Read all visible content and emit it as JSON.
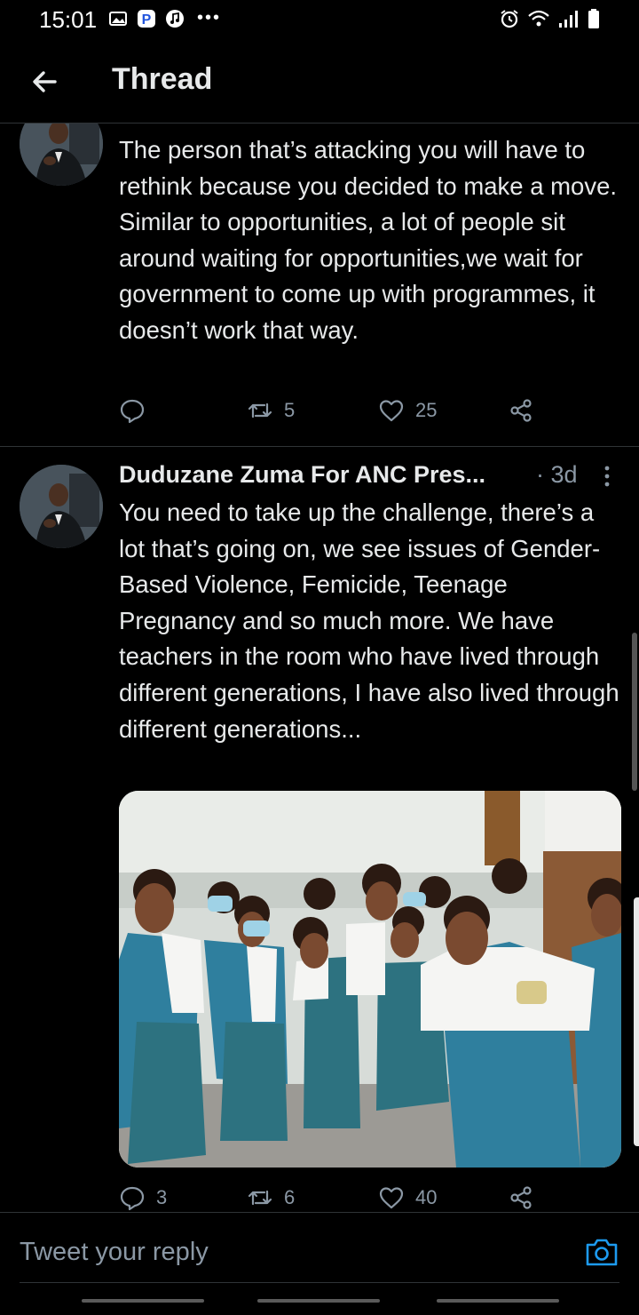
{
  "status_bar": {
    "time": "15:01",
    "dots": "•••"
  },
  "header": {
    "title": "Thread"
  },
  "tweets": [
    {
      "text": "The person that’s attacking you will have to rethink because you decided to  make a move. Similar to opportunities, a lot of people sit around waiting for opportunities,we wait for government to come up with programmes,  it doesn’t work that way.",
      "replies": "",
      "retweets": "5",
      "likes": "25"
    },
    {
      "author": "Duduzane Zuma For ANC Pres...",
      "meta": "· 3d",
      "text": "You need to take up the challenge, there’s a lot that’s going on, we see issues of Gender-Based Violence, Femicide, Teenage Pregnancy and so much more. We have teachers in the room who have lived through different generations, I have also lived through different generations...",
      "replies": "3",
      "retweets": "6",
      "likes": "40"
    }
  ],
  "reply": {
    "placeholder": "Tweet your reply"
  },
  "colors": {
    "background": "#000000",
    "text": "#e7e9ea",
    "muted": "#8b98a5",
    "accent": "#1d9bf0"
  },
  "icons": [
    "back-arrow-icon",
    "reply-icon",
    "retweet-icon",
    "like-icon",
    "share-icon",
    "more-icon",
    "camera-icon"
  ]
}
